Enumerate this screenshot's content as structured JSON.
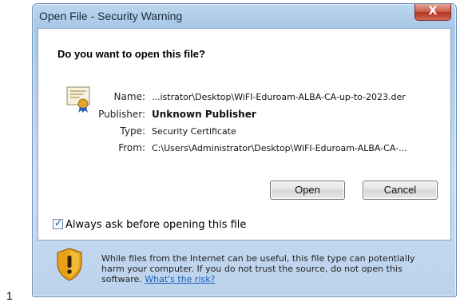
{
  "page_number": "1",
  "dialog": {
    "title": "Open File - Security Warning",
    "close_label": "X",
    "question": "Do you want to open this file?",
    "details": [
      {
        "label": "Name:",
        "value": "...istrator\\Desktop\\WiFI-Eduroam-ALBA-CA-up-to-2023.der",
        "bold": false
      },
      {
        "label": "Publisher:",
        "value": "Unknown Publisher",
        "bold": true
      },
      {
        "label": "Type:",
        "value": "Security Certificate",
        "bold": false
      },
      {
        "label": "From:",
        "value": "C:\\Users\\Administrator\\Desktop\\WiFI-Eduroam-ALBA-CA-...",
        "bold": false
      }
    ],
    "open_button": "Open",
    "cancel_button": "Cancel",
    "checkbox": {
      "label": "Always ask before opening this file",
      "checked": true
    },
    "warning_text": "While files from the Internet can be useful, this file type can potentially harm your computer. If you do not trust the source, do not open this software. ",
    "warning_link": "What's the risk?",
    "icons": {
      "certificate": "certificate-icon",
      "shield": "shield-warning-icon"
    }
  }
}
